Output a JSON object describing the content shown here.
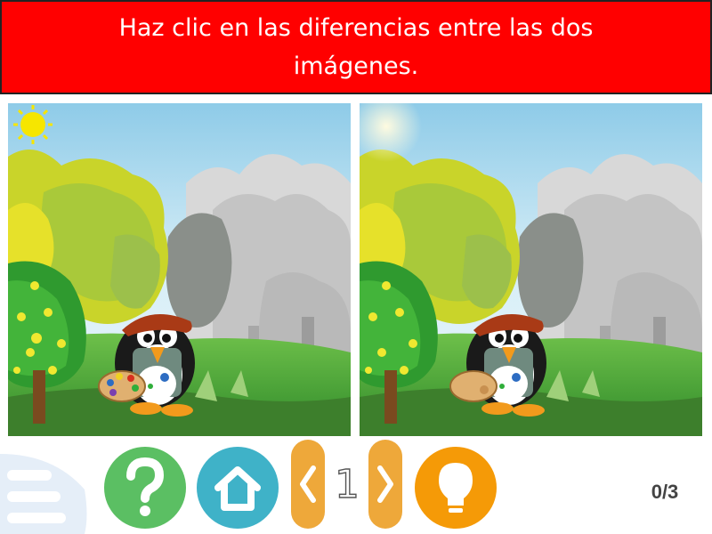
{
  "instruction": "Haz clic en las diferencias entre las dos imágenes.",
  "controls": {
    "page_number": "1",
    "score": "0/3"
  },
  "colors": {
    "header_bg": "#ff0000",
    "help_button": "#5bbf63",
    "home_button": "#3fb2c8",
    "arrow_buttons": "#eea83a",
    "hint_button": "#f59a07",
    "menu_button": "#c9ddf0"
  },
  "icons": {
    "help": "question-mark-icon",
    "home": "home-icon",
    "prev": "chevron-left-icon",
    "next": "chevron-right-icon",
    "hint": "lightbulb-icon",
    "menu": "hamburger-menu-icon"
  }
}
